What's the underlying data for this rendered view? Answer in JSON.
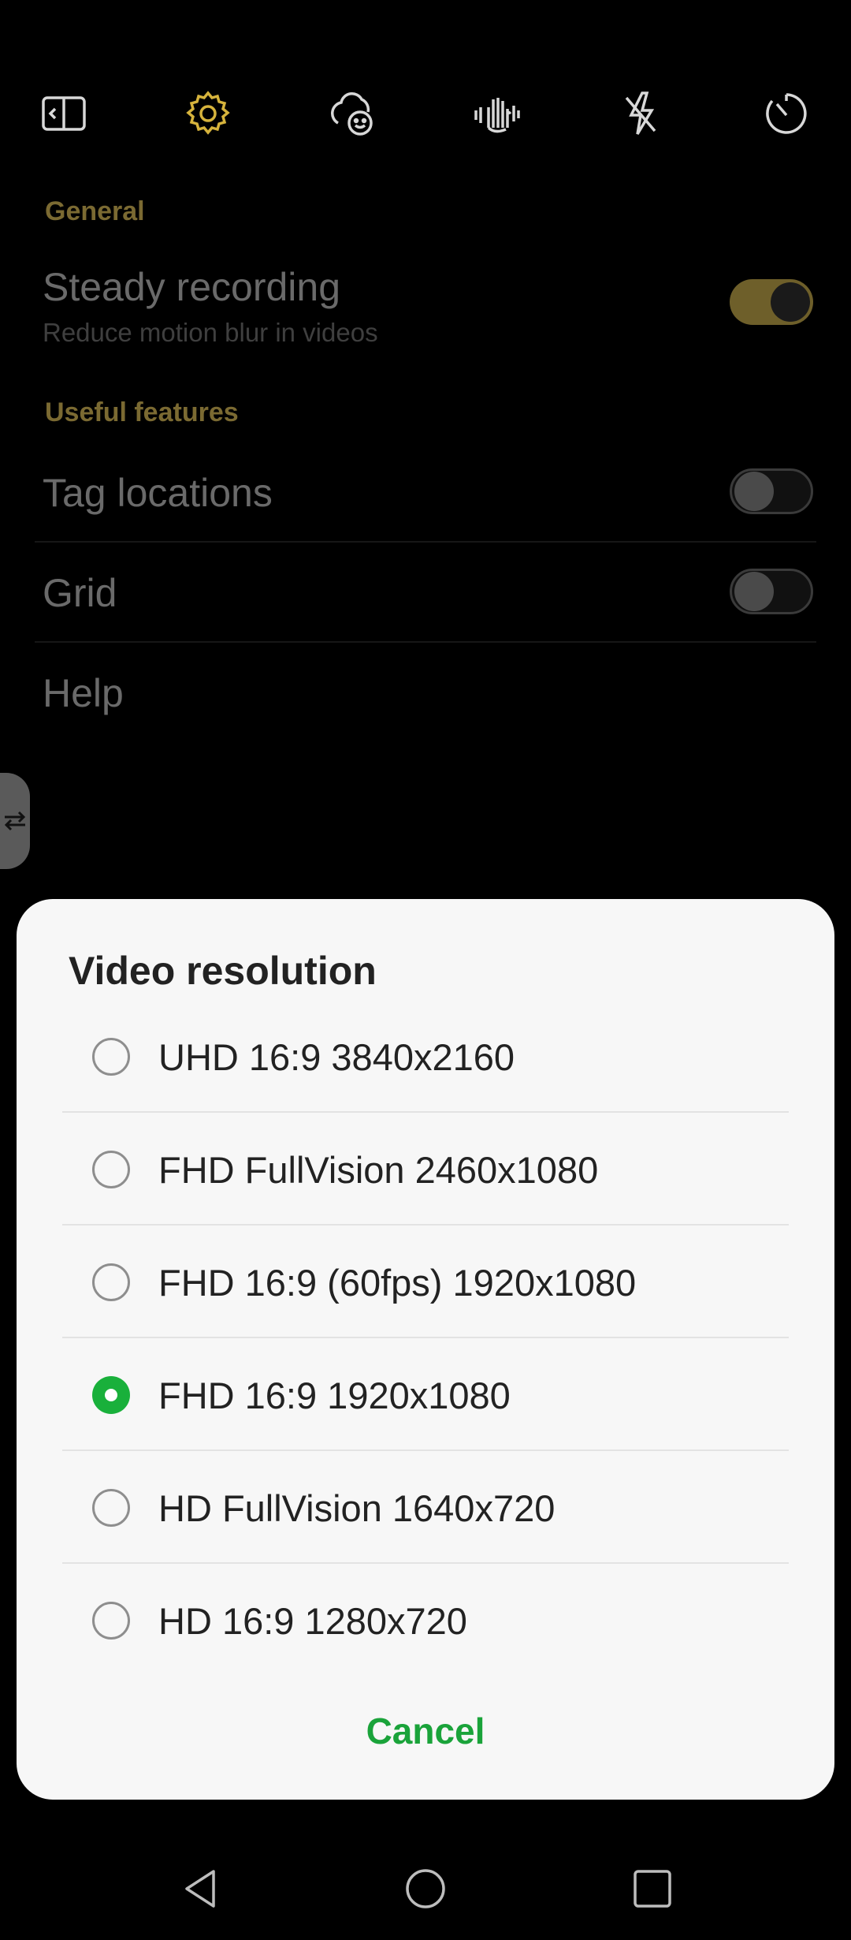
{
  "settings": {
    "section_general": "General",
    "steady_title": "Steady recording",
    "steady_sub": "Reduce motion blur in videos",
    "section_useful": "Useful features",
    "tag_title": "Tag locations",
    "grid_title": "Grid",
    "help_title": "Help"
  },
  "toggles": {
    "steady_recording": true,
    "tag_locations": false,
    "grid": false
  },
  "dialog": {
    "title": "Video resolution",
    "options": [
      {
        "label": "UHD 16:9 3840x2160",
        "selected": false
      },
      {
        "label": "FHD FullVision 2460x1080",
        "selected": false
      },
      {
        "label": "FHD 16:9 (60fps) 1920x1080",
        "selected": false
      },
      {
        "label": "FHD 16:9 1920x1080",
        "selected": true
      },
      {
        "label": "HD FullVision 1640x720",
        "selected": false
      },
      {
        "label": "HD 16:9 1280x720",
        "selected": false
      }
    ],
    "cancel_label": "Cancel"
  },
  "icons": {
    "toolbar": [
      "split-screen-icon",
      "gear-icon",
      "beauty-face-icon",
      "gesture-hand-icon",
      "flash-off-icon",
      "timer-icon"
    ],
    "nav": [
      "back-icon",
      "home-icon",
      "recents-icon"
    ]
  },
  "colors": {
    "accent_gold": "#c9a93a",
    "dimmed_gold": "#7b6a32",
    "selected_green": "#19b03b",
    "cancel_green": "#1aa33a"
  }
}
